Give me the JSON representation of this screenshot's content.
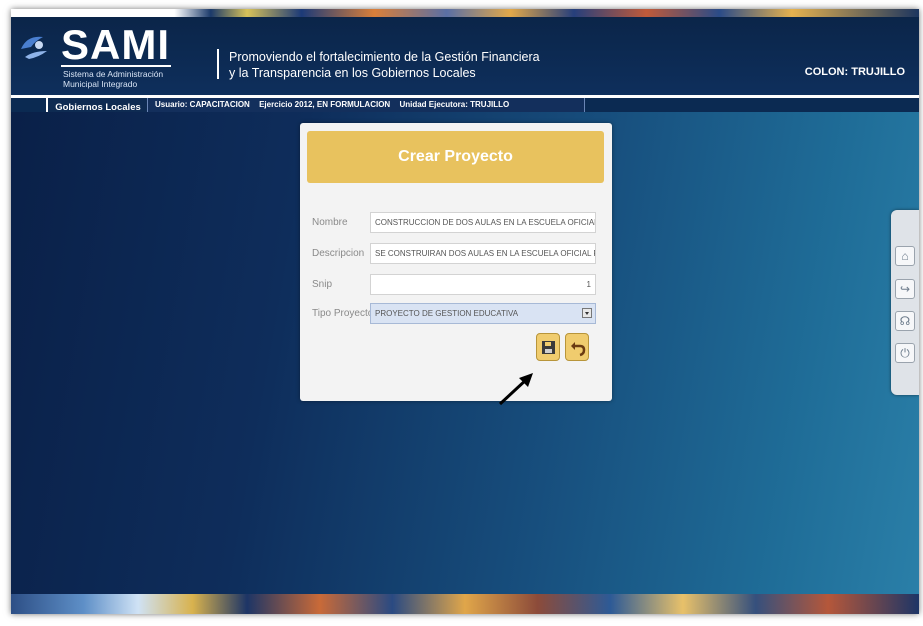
{
  "header": {
    "logo_text": "SAMI",
    "logo_subtitle_line1": "Sistema de Administración",
    "logo_subtitle_line2": "Municipal Integrado",
    "tagline_line1": "Promoviendo el fortalecimiento de la Gestión Financiera",
    "tagline_line2": "y la Transparencia en los Gobiernos Locales",
    "location": "COLON: TRUJILLO"
  },
  "nav": {
    "tab_label": "Gobiernos Locales",
    "usuario": "Usuario: CAPACITACION",
    "ejercicio": "Ejercicio 2012, EN FORMULACION",
    "unidad": "Unidad Ejecutora: TRUJILLO"
  },
  "form": {
    "title": "Crear Proyecto",
    "fields": [
      {
        "label": "Nombre",
        "value": "CONSTRUCCION DE DOS AULAS EN LA ESCUELA OFICIAL RURAL"
      },
      {
        "label": "Descripcion",
        "value": "SE CONSTRUIRAN DOS AULAS EN LA ESCUELA OFICIAL RURAL"
      },
      {
        "label": "Snip",
        "value": "1"
      },
      {
        "label": "Tipo Proyecto",
        "value": "PROYECTO DE GESTION EDUCATIVA"
      }
    ]
  },
  "side_tools": [
    "home-icon",
    "export-icon",
    "help-icon",
    "power-icon"
  ],
  "colors": {
    "header_bg": "#0b2549",
    "card_title_bg": "#e8c25e",
    "button_bg": "#f0cc6e",
    "select_bg": "#d9e3f3"
  }
}
